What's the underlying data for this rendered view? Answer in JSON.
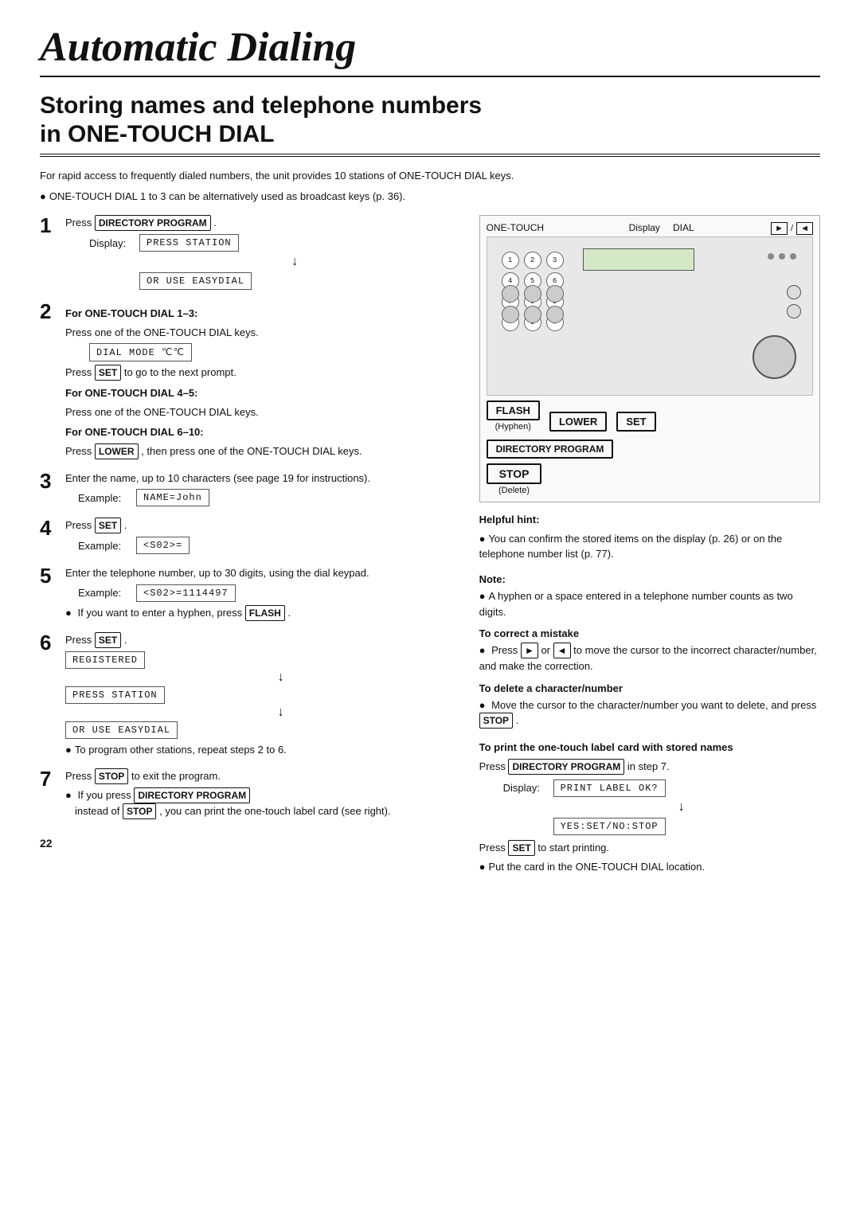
{
  "page": {
    "title": "Automatic Dialing",
    "section_title_line1": "Storing names and telephone numbers",
    "section_title_line2": "in ONE-TOUCH DIAL",
    "intro1": "For rapid access to frequently dialed numbers, the unit provides 10 stations of ONE-TOUCH DIAL keys.",
    "intro2": "ONE-TOUCH DIAL 1 to 3 can be alternatively used as broadcast keys (p. 36).",
    "page_number": "22"
  },
  "steps": [
    {
      "num": "1",
      "text_before": "Press",
      "key": "DIRECTORY PROGRAM",
      "text_after": ".",
      "display_label": "Display:",
      "display1": "PRESS STATION",
      "arrow": "↓",
      "display2": "OR USE EASYDIAL"
    },
    {
      "num": "2",
      "sub_heading": "For ONE-TOUCH DIAL 1–3:",
      "sub_text": "Press one of the ONE-TOUCH DIAL keys.",
      "display1": "DIAL MODE      ℃℃",
      "press_text_before": "Press",
      "press_key": "SET",
      "press_text_after": "to go to the next prompt.",
      "sub_heading2": "For ONE-TOUCH DIAL 4–5:",
      "sub_text2": "Press one of the ONE-TOUCH DIAL keys.",
      "sub_heading3": "For ONE-TOUCH DIAL 6–10:",
      "sub_text3_before": "Press",
      "sub_key3": "LOWER",
      "sub_text3_after": ", then press one of the ONE-TOUCH DIAL keys."
    },
    {
      "num": "3",
      "text": "Enter the name, up to 10 characters (see page 19 for instructions).",
      "example_label": "Example:",
      "example_display": "NAME=John"
    },
    {
      "num": "4",
      "text_before": "Press",
      "key": "SET",
      "text_after": ".",
      "example_label": "Example:",
      "example_display": "<S02>="
    },
    {
      "num": "5",
      "text": "Enter the telephone number, up to 30 digits, using the dial keypad.",
      "example_label": "Example:",
      "example_display": "<S02>=1114497",
      "bullet_before": "If you want to enter a hyphen, press",
      "bullet_key": "FLASH",
      "bullet_after": "."
    },
    {
      "num": "6",
      "text_before": "Press",
      "key": "SET",
      "text_after": ".",
      "display1": "REGISTERED",
      "arrow1": "↓",
      "display2": "PRESS STATION",
      "arrow2": "↓",
      "display3": "OR USE EASYDIAL",
      "bullet": "To program other stations, repeat steps 2 to 6."
    },
    {
      "num": "7",
      "text_before": "Press",
      "key": "STOP",
      "text_after": "to exit the program.",
      "bullet1_before": "If you press",
      "bullet1_key": "DIRECTORY PROGRAM",
      "bullet1_after": "instead of",
      "bullet1_key2": "STOP",
      "bullet1_after2": ", you can print the one-touch label card (see right)."
    }
  ],
  "right_col": {
    "device_labels": {
      "one_touch": "ONE-TOUCH",
      "display": "Display",
      "dial": "DIAL",
      "nav_left": "◄",
      "nav_right": "►"
    },
    "key_labels": {
      "flash": "FLASH",
      "flash_sub": "(Hyphen)",
      "lower": "LOWER",
      "set": "SET",
      "dir_program": "DIRECTORY PROGRAM",
      "stop": "STOP",
      "stop_sub": "(Delete)"
    },
    "helpful_hint": {
      "title": "Helpful hint:",
      "bullet1": "You can confirm the stored items on the display (p. 26) or on the telephone number list (p. 77)."
    },
    "note": {
      "title": "Note:",
      "bullet1": "A hyphen or a space entered in a telephone number counts as two digits."
    },
    "to_correct": {
      "title": "To correct a mistake",
      "bullet1_before": "Press",
      "bullet1_key1": "►",
      "bullet1_mid": "or",
      "bullet1_key2": "◄",
      "bullet1_after": "to move the cursor to the incorrect character/number, and make the correction."
    },
    "to_delete": {
      "title": "To delete a character/number",
      "bullet1_before": "Move the cursor to the character/number you want to delete, and press",
      "bullet1_key": "STOP",
      "bullet1_after": "."
    },
    "to_print": {
      "title": "To print the one-touch label card with stored names",
      "text_before": "Press",
      "key": "DIRECTORY PROGRAM",
      "text_after": "in step 7.",
      "display_label": "Display:",
      "display1": "PRINT LABEL OK?",
      "arrow": "↓",
      "display2": "YES:SET/NO:STOP",
      "press_before": "Press",
      "press_key": "SET",
      "press_after": "to start printing.",
      "bullet1": "Put the card in the ONE-TOUCH DIAL location."
    }
  }
}
